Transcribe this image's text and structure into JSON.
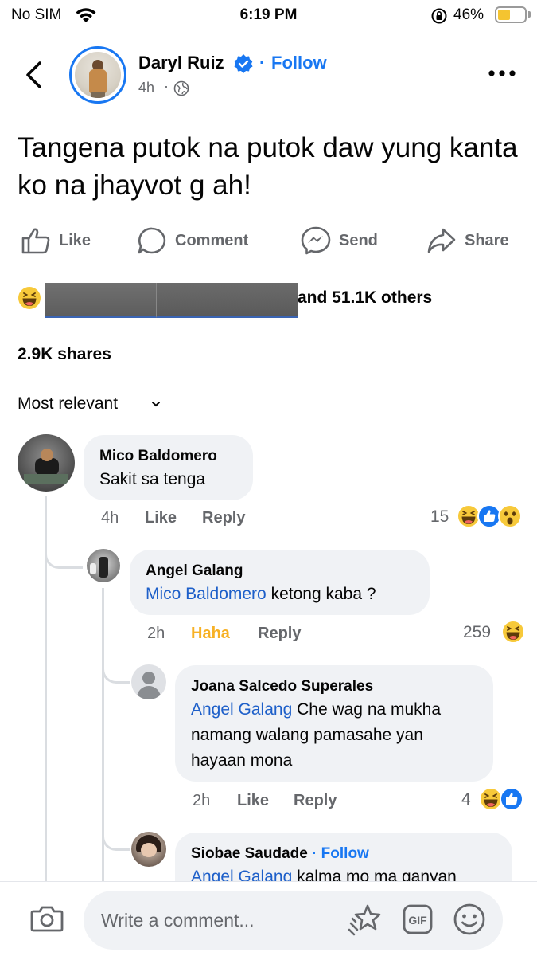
{
  "status": {
    "carrier": "No SIM",
    "time": "6:19 PM",
    "battery": "46%"
  },
  "post": {
    "author": "Daryl Ruiz",
    "follow_label": "Follow",
    "time": "4h",
    "text": "Tangena putok na putok daw yung kanta ko na jhayvot g ah!"
  },
  "actions": {
    "like": "Like",
    "comment": "Comment",
    "send": "Send",
    "share": "Share"
  },
  "reactions": {
    "others": "and 51.1K others"
  },
  "shares": "2.9K shares",
  "sort": "Most relevant",
  "comments": [
    {
      "name": "Mico Baldomero",
      "text": "Sakit sa tenga",
      "time": "4h",
      "like": "Like",
      "reply": "Reply",
      "count": "15"
    },
    {
      "name": "Angel Galang",
      "mention": "Mico Baldomero",
      "text": " ketong kaba ?",
      "time": "2h",
      "like": "Haha",
      "reply": "Reply",
      "count": "259"
    },
    {
      "name": "Joana Salcedo Superales",
      "mention": "Angel Galang",
      "text_line1": " Che wag na mukha",
      "text_line2": "namang walang pamasahe yan",
      "text_line3": "hayaan mona",
      "time": "2h",
      "like": "Like",
      "reply": "Reply",
      "count": "4"
    },
    {
      "name": "Siobae Saudade",
      "follow": "Follow",
      "mention": "Angel Galang",
      "text": " kalma mo ma ganyan"
    }
  ],
  "composer": {
    "placeholder": "Write a comment..."
  }
}
